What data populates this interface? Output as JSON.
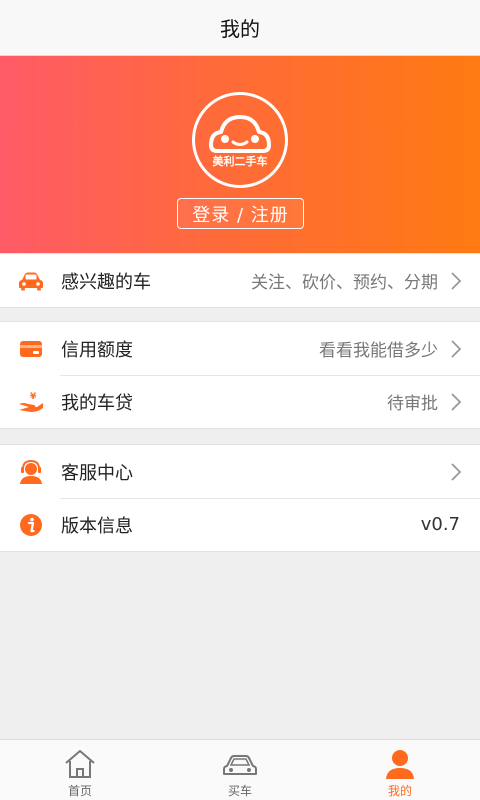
{
  "header": {
    "title": "我的"
  },
  "hero": {
    "logo_text": "美利二手车",
    "login_label": "登录 / 注册"
  },
  "groups": [
    {
      "rows": [
        {
          "label": "感兴趣的车",
          "value": "关注、砍价、预约、分期",
          "icon": "car-icon"
        }
      ]
    },
    {
      "rows": [
        {
          "label": "信用额度",
          "value": "看看我能借多少",
          "icon": "credit-card-icon"
        },
        {
          "label": "我的车贷",
          "value": "待审批",
          "icon": "hand-coin-icon"
        }
      ]
    },
    {
      "rows": [
        {
          "label": "客服中心",
          "value": "",
          "icon": "headset-agent-icon"
        },
        {
          "label": "版本信息",
          "value": "v0.7",
          "icon": "info-icon"
        }
      ]
    }
  ],
  "tabs": [
    {
      "label": "首页",
      "icon": "home-icon",
      "active": false
    },
    {
      "label": "买车",
      "icon": "car-outline-icon",
      "active": false
    },
    {
      "label": "我的",
      "icon": "person-icon",
      "active": true
    }
  ],
  "colors": {
    "accent": "#ff6a1f",
    "gradient_start": "#ff5a67",
    "gradient_end": "#ff7a12"
  }
}
